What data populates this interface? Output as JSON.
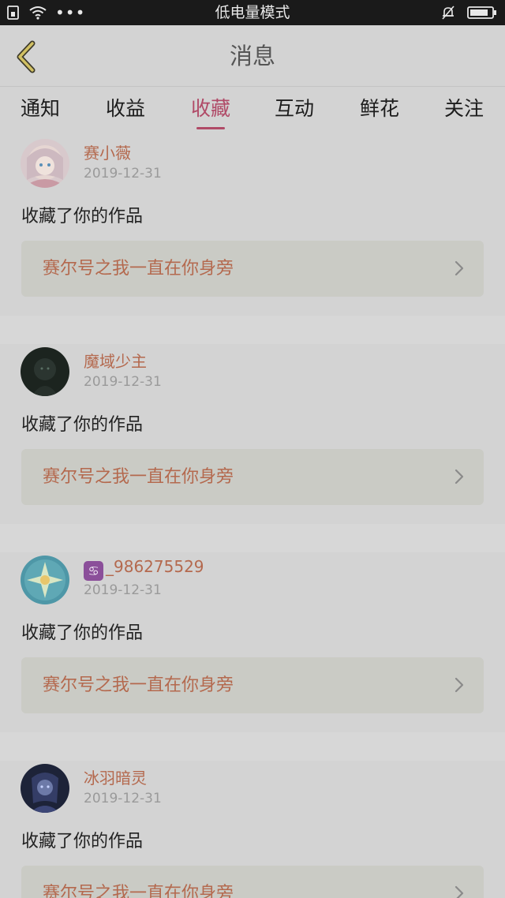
{
  "status_bar": {
    "title": "低电量模式",
    "icons": [
      "sim-icon",
      "wifi-icon",
      "more-dots-icon",
      "bell-muted-icon",
      "battery-icon"
    ]
  },
  "header": {
    "title": "消息",
    "back_icon": "chevron-left-icon"
  },
  "tabs": [
    {
      "label": "通知"
    },
    {
      "label": "收益"
    },
    {
      "label": "收藏",
      "active": true
    },
    {
      "label": "互动"
    },
    {
      "label": "鲜花"
    },
    {
      "label": "关注"
    }
  ],
  "feed": [
    {
      "name": "赛小薇",
      "date": "2019-12-31",
      "action": "收藏了你的作品",
      "work": "赛尔号之我一直在你身旁"
    },
    {
      "name": "魔域少主",
      "date": "2019-12-31",
      "action": "收藏了你的作品",
      "work": "赛尔号之我一直在你身旁"
    },
    {
      "badge": "♋",
      "name": "_986275529",
      "date": "2019-12-31",
      "action": "收藏了你的作品",
      "work": "赛尔号之我一直在你身旁"
    },
    {
      "name": "冰羽暗灵",
      "date": "2019-12-31",
      "action": "收藏了你的作品",
      "work": "赛尔号之我一直在你身旁"
    }
  ],
  "colors": {
    "accent": "#b04a67",
    "name_text": "#b4694e",
    "status_bar_bg": "#1a1a1a"
  }
}
